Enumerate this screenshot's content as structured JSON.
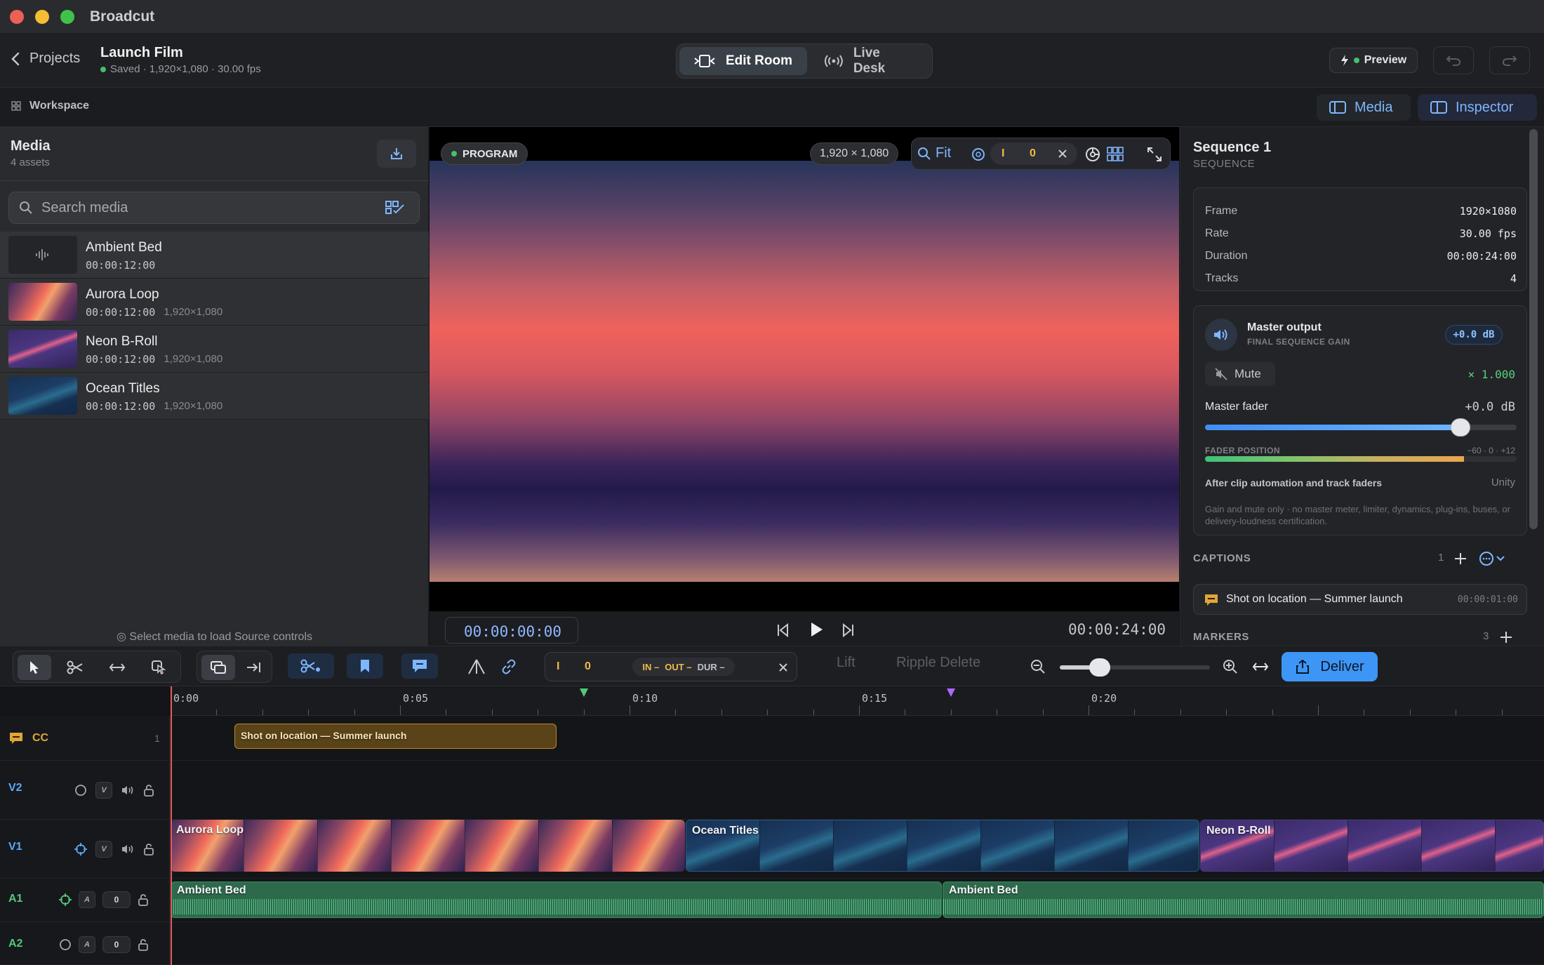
{
  "app": {
    "title": "Broadcut"
  },
  "header": {
    "back_label": "Projects",
    "project_title": "Launch Film",
    "project_meta": "Saved · 1,920×1,080 · 30.00 fps",
    "modes": [
      {
        "label": "Edit Room"
      },
      {
        "label": "Live Desk"
      }
    ],
    "preview_label": "Preview"
  },
  "workspace": {
    "label": "Workspace",
    "media_toggle": "Media",
    "inspector_toggle": "Inspector"
  },
  "media": {
    "title": "Media",
    "count": "4 assets",
    "search_placeholder": "Search media",
    "assets": [
      {
        "name": "Ambient Bed",
        "duration": "00:00:12:00",
        "resolution": ""
      },
      {
        "name": "Aurora Loop",
        "duration": "00:00:12:00",
        "resolution": "1,920×1,080"
      },
      {
        "name": "Neon B-Roll",
        "duration": "00:00:12:00",
        "resolution": "1,920×1,080"
      },
      {
        "name": "Ocean Titles",
        "duration": "00:00:12:00",
        "resolution": "1,920×1,080"
      }
    ],
    "hint": "Select media to load Source controls"
  },
  "viewer": {
    "badge": "PROGRAM",
    "resolution": "1,920 × 1,080",
    "zoom": "Fit",
    "in_marker": "I",
    "in_value": "0",
    "current_tc": "00:00:00:00",
    "total_tc": "00:00:24:00"
  },
  "inspector": {
    "title": "Sequence 1",
    "subtitle": "SEQUENCE",
    "props": [
      {
        "k": "Frame",
        "v": "1920×1080"
      },
      {
        "k": "Rate",
        "v": "30.00 fps"
      },
      {
        "k": "Duration",
        "v": "00:00:24:00"
      },
      {
        "k": "Tracks",
        "v": "4"
      }
    ],
    "master": {
      "title": "Master output",
      "subtitle": "FINAL SEQUENCE GAIN",
      "gain_badge": "+0.0 dB",
      "mute_label": "Mute",
      "multiplier": "× 1.000",
      "fader_label": "Master fader",
      "fader_db": "+0.0 dB",
      "fader_level": 0.82,
      "position_label": "FADER POSITION",
      "position_scale": "−60 · 0 · +12",
      "position_level": 0.83,
      "after_note": "After clip automation and track faders",
      "unity": "Unity",
      "note": "Gain and mute only · no master meter, limiter, dynamics, plug-ins, buses, or delivery-loudness certification."
    },
    "captions_label": "CAPTIONS",
    "captions_count": "1",
    "caption": {
      "text": "Shot on location — Summer launch",
      "tc": "00:00:01:00"
    },
    "markers_label": "MARKERS",
    "markers_count": "3"
  },
  "toolbar": {
    "in_marker": "I",
    "in_value": "0",
    "in_label": "IN –",
    "out_label": "OUT –",
    "dur_label": "DUR –",
    "lift": "Lift",
    "ripple": "Ripple Delete",
    "deliver": "Deliver"
  },
  "timeline": {
    "ruler": [
      "0:00",
      "0:05",
      "0:10",
      "0:15",
      "0:20"
    ],
    "tracks": [
      {
        "name": "CC",
        "color": "#e0a63a",
        "count": "1"
      },
      {
        "name": "V2",
        "color": "#5aa7ff"
      },
      {
        "name": "V1",
        "color": "#5aa7ff"
      },
      {
        "name": "A1",
        "color": "#53c77c",
        "level": "0"
      },
      {
        "name": "A2",
        "color": "#53c77c",
        "level": "0"
      }
    ],
    "caption_clip": "Shot on location — Summer launch",
    "v1_clips": [
      "Aurora Loop",
      "Ocean Titles",
      "Neon B-Roll"
    ],
    "a1_clips": [
      "Ambient Bed",
      "Ambient Bed"
    ]
  },
  "colors": {
    "accent": "#3d96f5",
    "record": "#e85b5b",
    "saved": "#44c06a"
  }
}
